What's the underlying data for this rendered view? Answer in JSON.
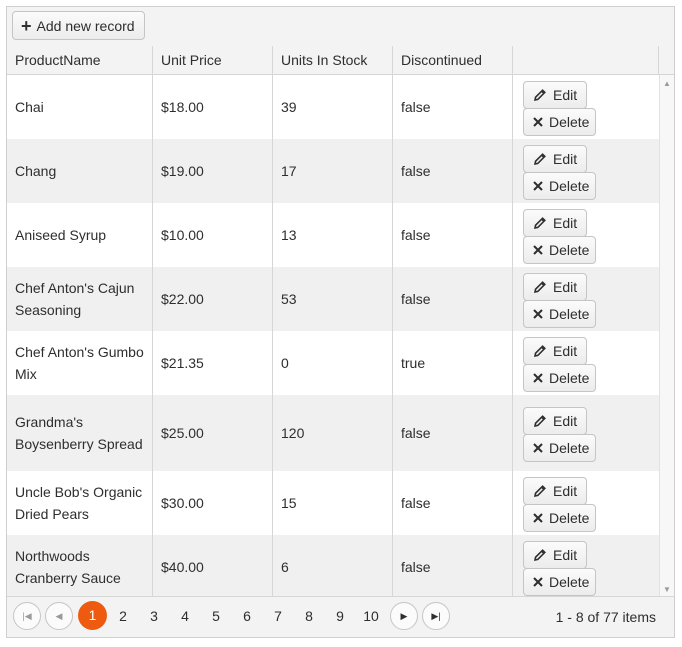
{
  "toolbar": {
    "add_label": "Add new record"
  },
  "columns": [
    "ProductName",
    "Unit Price",
    "Units In Stock",
    "Discontinued",
    ""
  ],
  "rows": [
    {
      "name": "Chai",
      "price": "$18.00",
      "stock": "39",
      "discontinued": "false"
    },
    {
      "name": "Chang",
      "price": "$19.00",
      "stock": "17",
      "discontinued": "false"
    },
    {
      "name": "Aniseed Syrup",
      "price": "$10.00",
      "stock": "13",
      "discontinued": "false"
    },
    {
      "name": "Chef Anton's Cajun Seasoning",
      "price": "$22.00",
      "stock": "53",
      "discontinued": "false"
    },
    {
      "name": "Chef Anton's Gumbo Mix",
      "price": "$21.35",
      "stock": "0",
      "discontinued": "true"
    },
    {
      "name": "Grandma's Boysenberry Spread",
      "price": "$25.00",
      "stock": "120",
      "discontinued": "false"
    },
    {
      "name": "Uncle Bob's Organic Dried Pears",
      "price": "$30.00",
      "stock": "15",
      "discontinued": "false"
    },
    {
      "name": "Northwoods Cranberry Sauce",
      "price": "$40.00",
      "stock": "6",
      "discontinued": "false"
    }
  ],
  "row_actions": {
    "edit_label": "Edit",
    "delete_label": "Delete"
  },
  "pager": {
    "pages": [
      "1",
      "2",
      "3",
      "4",
      "5",
      "6",
      "7",
      "8",
      "9",
      "10"
    ],
    "current_page": "1",
    "info": "1 - 8 of 77 items"
  },
  "icons": {
    "add": "plus-icon",
    "edit": "pencil-icon",
    "delete": "close-icon",
    "first": "first-page-icon",
    "prev": "prev-page-icon",
    "next": "next-page-icon",
    "last": "last-page-icon"
  },
  "colors": {
    "accent": "#ef5a11",
    "header_bg": "#f3f3f3",
    "alt_row": "#f0f0f0",
    "border": "#d6d6d6"
  }
}
